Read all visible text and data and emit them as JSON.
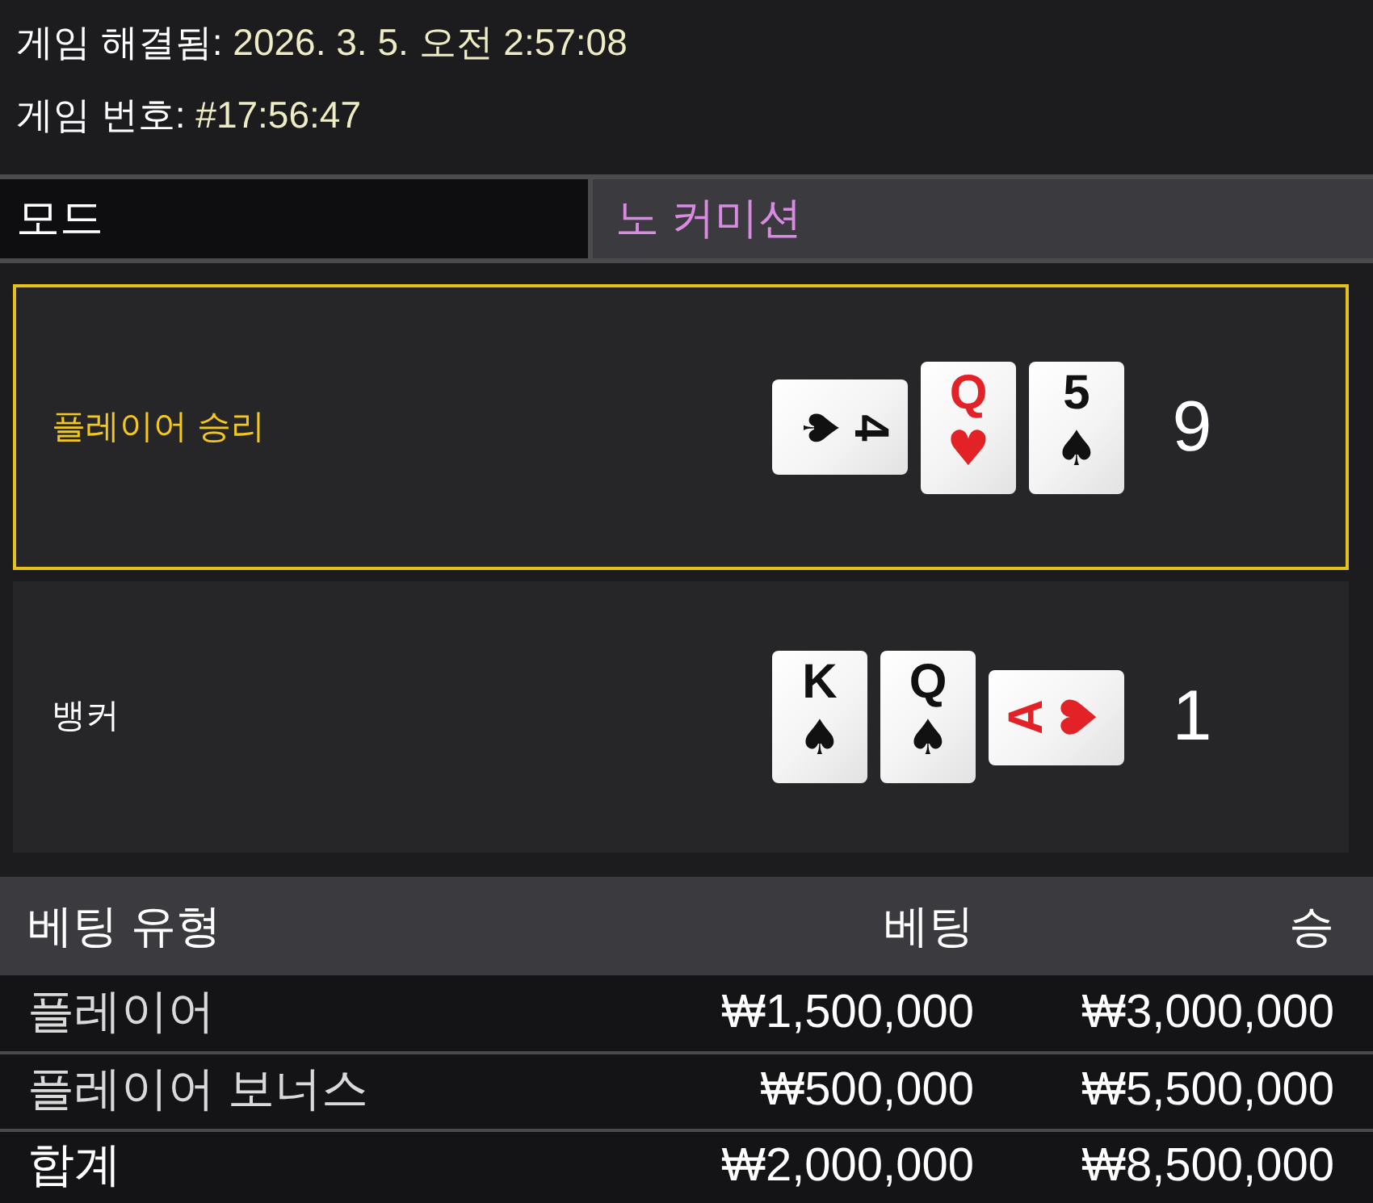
{
  "header": {
    "lines": [
      {
        "label": "게임 해결됨:",
        "value": "2026. 3. 5. 오전 2:57:08"
      },
      {
        "label": "게임 번호:",
        "value": "#17:56:47"
      }
    ]
  },
  "mode": {
    "label": "모드",
    "value": "노 커미션"
  },
  "hands": [
    {
      "label": "플레이어 승리",
      "winner": true,
      "cards": [
        {
          "kind": "rightward",
          "rank": "4",
          "suit": "♠",
          "color": "#111111"
        },
        {
          "kind": "upright",
          "rank": "Q",
          "suit": "♥",
          "color": "#e32228"
        },
        {
          "kind": "upright",
          "rank": "5",
          "suit": "♠",
          "color": "#111111"
        }
      ],
      "score": "9"
    },
    {
      "label": "뱅커",
      "winner": false,
      "cards": [
        {
          "kind": "upright",
          "rank": "K",
          "suit": "♠",
          "color": "#111111"
        },
        {
          "kind": "upright",
          "rank": "Q",
          "suit": "♠",
          "color": "#111111"
        },
        {
          "kind": "leftward",
          "rank": "A",
          "suit": "♥",
          "color": "#e32228"
        }
      ],
      "score": "1"
    }
  ],
  "bets_table": {
    "columns": [
      "베팅 유형",
      "베팅",
      "승"
    ],
    "rows": [
      {
        "kind": "bet",
        "cells": [
          "플레이어",
          "₩1,500,000",
          "₩3,000,000"
        ]
      },
      {
        "kind": "bet",
        "cells": [
          "플레이어 보너스",
          "₩500,000",
          "₩5,500,000"
        ]
      },
      {
        "kind": "total",
        "cells": [
          "합계",
          "₩2,000,000",
          "₩8,500,000"
        ]
      }
    ]
  }
}
